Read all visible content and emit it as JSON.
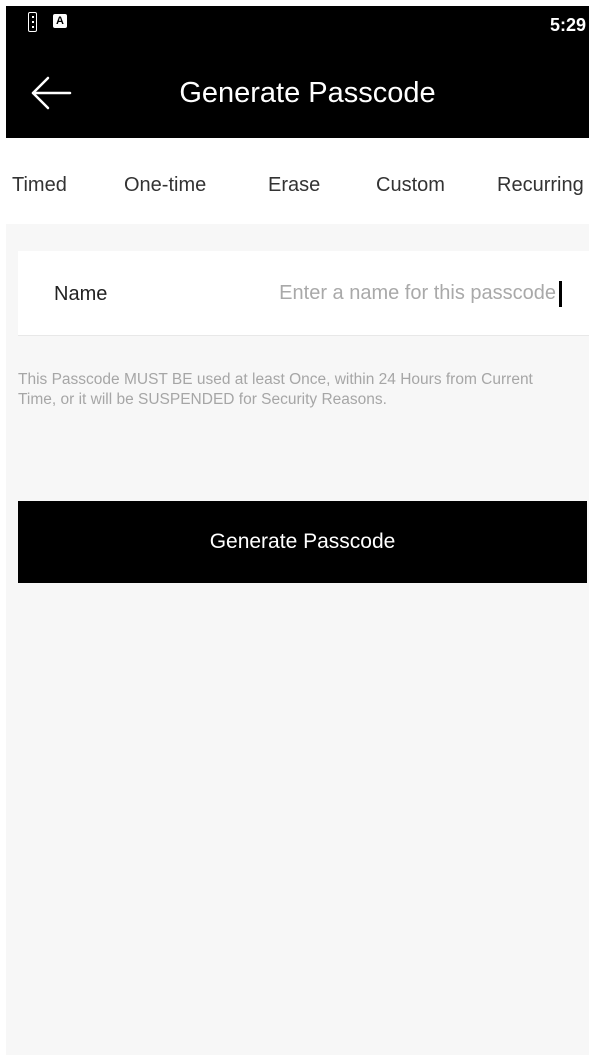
{
  "status_bar": {
    "time": "5:29",
    "icons": [
      "sim-card-icon",
      "a-letter-icon"
    ],
    "a_icon_text": "A"
  },
  "header": {
    "title": "Generate Passcode",
    "back_icon": "back-arrow-icon"
  },
  "tabs": [
    {
      "label": "Timed"
    },
    {
      "label": "One-time"
    },
    {
      "label": "Erase"
    },
    {
      "label": "Custom"
    },
    {
      "label": "Recurring"
    }
  ],
  "form": {
    "name_label": "Name",
    "name_value": "",
    "name_placeholder": "Enter a name for this passcode"
  },
  "note": "This Passcode MUST BE used at least Once, within 24 Hours from Current Time, or it will be SUSPENDED for Security Reasons.",
  "actions": {
    "generate_label": "Generate Passcode"
  },
  "colors": {
    "bar_background": "#000000",
    "page_background": "#f7f7f7",
    "note_text": "#a6a6a6",
    "button_background": "#000000"
  }
}
